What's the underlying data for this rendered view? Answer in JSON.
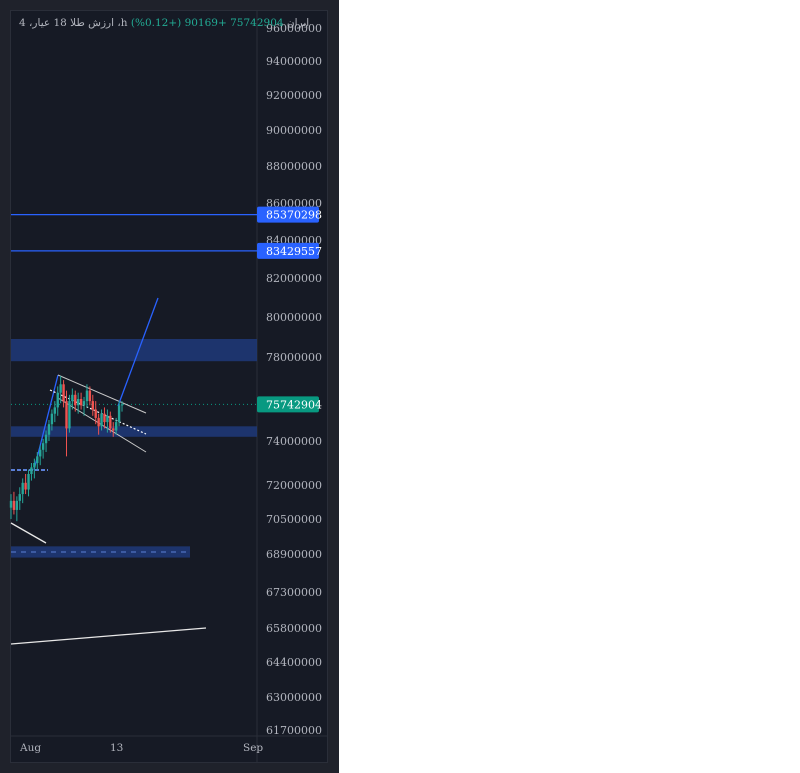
{
  "legend": {
    "symbol": "4 ،ارزش طلا 18 عیار ،h ایران",
    "last": "75742904",
    "change": "+90169 (+0.12%)"
  },
  "colors": {
    "background": "#161a25",
    "frame": "#1f222b",
    "up": "#26a69a",
    "down": "#ef5350",
    "drawing_blue": "#2962ff",
    "zone": "#1e3a7a",
    "current_price": "#089981",
    "text": "#b2b5be"
  },
  "chart_data": {
    "type": "candlestick",
    "y_axis_ticks": [
      96000000,
      94000000,
      92000000,
      90000000,
      88000000,
      86000000,
      84000000,
      82000000,
      80000000,
      78000000,
      74000000,
      72000000,
      70500000,
      68900000,
      67300000,
      65800000,
      64400000,
      63000000,
      61700000
    ],
    "x_axis_ticks": [
      "Aug",
      "13",
      "Sep"
    ],
    "ylim": [
      61700000,
      96000000
    ],
    "current_price": 75742904,
    "price_labels": [
      {
        "value": 85370298,
        "label": "85370298",
        "color": "#2962ff"
      },
      {
        "value": 83429557,
        "label": "83429557",
        "color": "#2962ff"
      },
      {
        "value": 75742904,
        "label": "75742904",
        "color": "#089981"
      }
    ],
    "horizontal_lines": [
      85370298,
      83429557
    ],
    "zones": [
      {
        "from": 77800000,
        "to": 78900000
      },
      {
        "from": 74200000,
        "to": 74700000
      },
      {
        "from": 68750000,
        "to": 69250000,
        "dashed": true
      }
    ],
    "candles": [
      {
        "o": 71000000,
        "h": 71600000,
        "l": 70500000,
        "c": 71300000
      },
      {
        "o": 71300000,
        "h": 71700000,
        "l": 70700000,
        "c": 70900000
      },
      {
        "o": 70900000,
        "h": 71500000,
        "l": 70400000,
        "c": 71300000
      },
      {
        "o": 71300000,
        "h": 71900000,
        "l": 70900000,
        "c": 71600000
      },
      {
        "o": 71600000,
        "h": 72300000,
        "l": 71200000,
        "c": 72100000
      },
      {
        "o": 72100000,
        "h": 72500000,
        "l": 71600000,
        "c": 71800000
      },
      {
        "o": 71800000,
        "h": 72700000,
        "l": 71500000,
        "c": 72500000
      },
      {
        "o": 72500000,
        "h": 73000000,
        "l": 72200000,
        "c": 72800000
      },
      {
        "o": 72800000,
        "h": 73200000,
        "l": 72300000,
        "c": 73000000
      },
      {
        "o": 73000000,
        "h": 73500000,
        "l": 72700000,
        "c": 73300000
      },
      {
        "o": 73300000,
        "h": 73800000,
        "l": 72900000,
        "c": 73600000
      },
      {
        "o": 73600000,
        "h": 74100000,
        "l": 73200000,
        "c": 73900000
      },
      {
        "o": 73900000,
        "h": 74500000,
        "l": 73500000,
        "c": 74300000
      },
      {
        "o": 74300000,
        "h": 75000000,
        "l": 74000000,
        "c": 74800000
      },
      {
        "o": 74800000,
        "h": 75500000,
        "l": 74500000,
        "c": 75300000
      },
      {
        "o": 75300000,
        "h": 75900000,
        "l": 74900000,
        "c": 75600000
      },
      {
        "o": 75600000,
        "h": 76600000,
        "l": 75200000,
        "c": 76300000
      },
      {
        "o": 76300000,
        "h": 77100000,
        "l": 75800000,
        "c": 76700000
      },
      {
        "o": 76700000,
        "h": 76900000,
        "l": 75600000,
        "c": 75900000
      },
      {
        "o": 75900000,
        "h": 76400000,
        "l": 73300000,
        "c": 74600000
      },
      {
        "o": 74600000,
        "h": 76200000,
        "l": 74400000,
        "c": 75900000
      },
      {
        "o": 75900000,
        "h": 76500000,
        "l": 75500000,
        "c": 76200000
      },
      {
        "o": 76200000,
        "h": 76400000,
        "l": 75400000,
        "c": 75700000
      },
      {
        "o": 75700000,
        "h": 76300000,
        "l": 75300000,
        "c": 76000000
      },
      {
        "o": 76000000,
        "h": 76300000,
        "l": 75500000,
        "c": 75700000
      },
      {
        "o": 75700000,
        "h": 76100000,
        "l": 75200000,
        "c": 75900000
      },
      {
        "o": 75900000,
        "h": 76700000,
        "l": 75600000,
        "c": 76400000
      },
      {
        "o": 76400000,
        "h": 76600000,
        "l": 75700000,
        "c": 75900000
      },
      {
        "o": 75900000,
        "h": 76200000,
        "l": 75200000,
        "c": 75500000
      },
      {
        "o": 75500000,
        "h": 75900000,
        "l": 74800000,
        "c": 75100000
      },
      {
        "o": 75100000,
        "h": 75300000,
        "l": 74300000,
        "c": 74700000
      },
      {
        "o": 74700000,
        "h": 75500000,
        "l": 74500000,
        "c": 75300000
      },
      {
        "o": 75300000,
        "h": 75600000,
        "l": 74600000,
        "c": 74900000
      },
      {
        "o": 74900000,
        "h": 75500000,
        "l": 74400000,
        "c": 75200000
      },
      {
        "o": 75200000,
        "h": 75400000,
        "l": 74400000,
        "c": 74600000
      },
      {
        "o": 74600000,
        "h": 74900000,
        "l": 74200000,
        "c": 74500000
      },
      {
        "o": 74500000,
        "h": 75100000,
        "l": 74300000,
        "c": 74900000
      },
      {
        "o": 74900000,
        "h": 75900000,
        "l": 74700000,
        "c": 75700000
      },
      {
        "o": 75700000,
        "h": 75900000,
        "l": 75400000,
        "c": 75742904
      }
    ]
  }
}
